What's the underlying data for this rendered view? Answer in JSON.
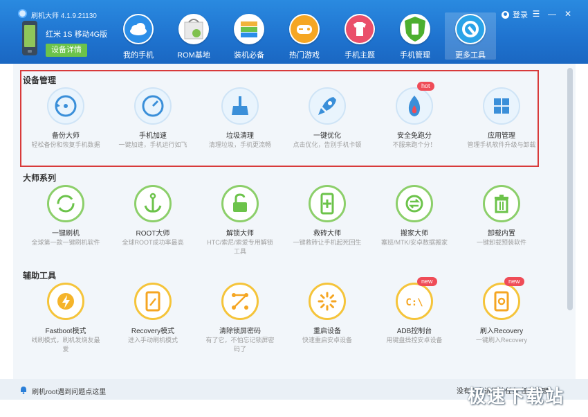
{
  "app": {
    "title": "刷机大师 4.1.9.21130",
    "login": "登录"
  },
  "window_controls": {
    "menu": "☰",
    "minimize": "—",
    "close": "✕"
  },
  "device": {
    "name": "红米 1S 移动4G版",
    "detail_button": "设备详情"
  },
  "nav": {
    "tabs": [
      {
        "label": "我的手机",
        "icon": "cloud-icon"
      },
      {
        "label": "ROM基地",
        "icon": "rom-bag-icon"
      },
      {
        "label": "装机必备",
        "icon": "apps-stack-icon"
      },
      {
        "label": "热门游戏",
        "icon": "gamepad-icon"
      },
      {
        "label": "手机主题",
        "icon": "tshirt-icon"
      },
      {
        "label": "手机管理",
        "icon": "shield-phone-icon"
      },
      {
        "label": "更多工具",
        "icon": "gear-tools-icon"
      }
    ]
  },
  "sections": {
    "device_mgmt": {
      "title": "设备管理",
      "items": [
        {
          "name": "备份大师",
          "desc": "轻松备份和恢复手机数据",
          "icon": "backup-icon"
        },
        {
          "name": "手机加速",
          "desc": "一键加速，手机运行如飞",
          "icon": "speedometer-icon"
        },
        {
          "name": "垃圾清理",
          "desc": "清理垃圾，手机更流畅",
          "icon": "broom-icon"
        },
        {
          "name": "一键优化",
          "desc": "点击优化，告别手机卡顿",
          "icon": "rocket-icon"
        },
        {
          "name": "安全免跑分",
          "desc": "不服来跑个分！",
          "icon": "flame-icon",
          "badge": "hot"
        },
        {
          "name": "应用管理",
          "desc": "管理手机软件升级与卸载",
          "icon": "app-grid-icon"
        }
      ]
    },
    "master_series": {
      "title": "大师系列",
      "items": [
        {
          "name": "一键刷机",
          "desc": "全球第一款一键刷机软件",
          "icon": "refresh-icon"
        },
        {
          "name": "ROOT大师",
          "desc": "全球ROOT成功率最高",
          "icon": "anchor-icon"
        },
        {
          "name": "解锁大师",
          "desc": "HTC/索尼/索爱专用解锁工具",
          "icon": "unlock-icon"
        },
        {
          "name": "救砖大师",
          "desc": "一键救砖让手机起死回生",
          "icon": "phone-plus-icon"
        },
        {
          "name": "搬家大师",
          "desc": "塞班/MTK/安卓数据搬家",
          "icon": "transfer-icon"
        },
        {
          "name": "卸载内置",
          "desc": "一键卸载预装软件",
          "icon": "trash-icon"
        }
      ]
    },
    "aux_tools": {
      "title": "辅助工具",
      "items": [
        {
          "name": "Fastboot模式",
          "desc": "线刷模式，刷机发烧友最爱",
          "icon": "lightning-icon"
        },
        {
          "name": "Recovery模式",
          "desc": "进入手动刷机模式",
          "icon": "tablet-icon"
        },
        {
          "name": "清除锁屏密码",
          "desc": "有了它，不怕忘记锁屏密码了",
          "icon": "pattern-lock-icon"
        },
        {
          "name": "重启设备",
          "desc": "快速重启安卓设备",
          "icon": "spinner-icon"
        },
        {
          "name": "ADB控制台",
          "desc": "用键盘操控安卓设备",
          "icon": "terminal-icon",
          "badge": "new"
        },
        {
          "name": "刷入Recovery",
          "desc": "一键刷入Recovery",
          "icon": "flash-recovery-icon",
          "badge": "new"
        }
      ]
    }
  },
  "statusbar": {
    "text": "刷机root遇到问题点这里",
    "right": "没有正在进行的任务   任务管理"
  },
  "watermark": "极速下载站",
  "colors": {
    "header": "#1f73cf",
    "green": "#6cc34a",
    "highlight_border": "#d83a3a",
    "badge": "#ef4c57",
    "yellow_ring": "#f5c43a",
    "green_ring": "#8ccf6a"
  }
}
